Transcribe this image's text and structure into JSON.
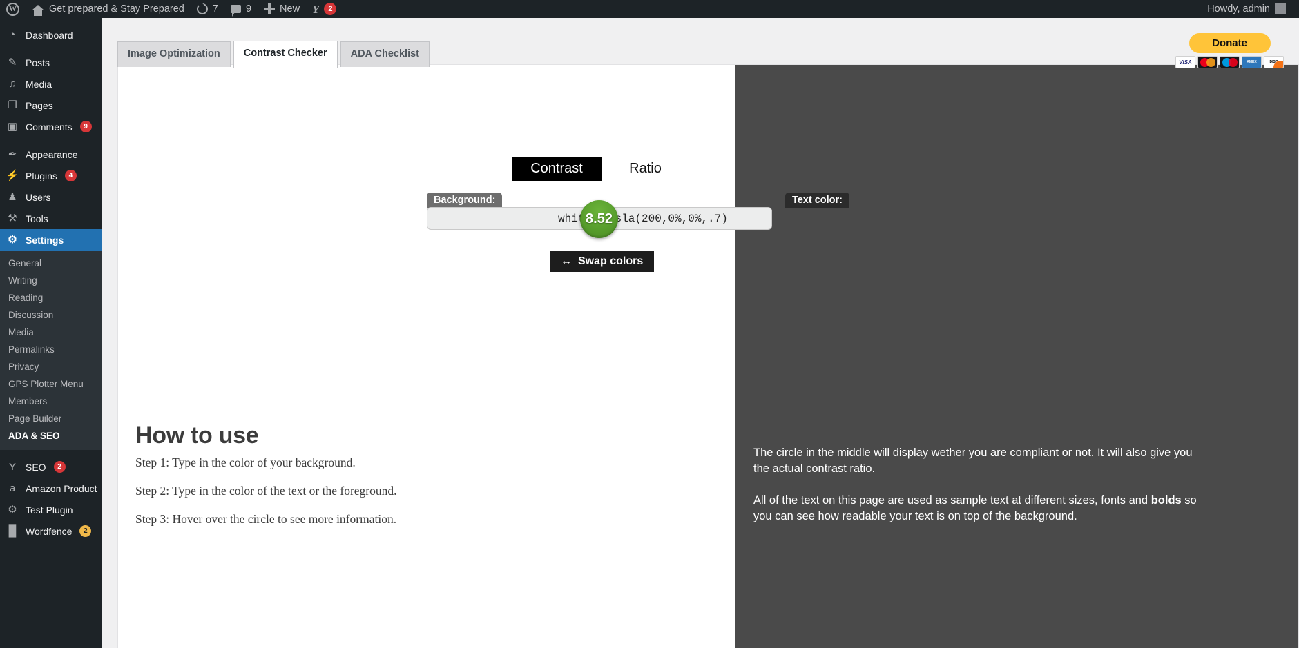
{
  "adminbar": {
    "wp_logo": "wordpress-logo-icon",
    "site_name": "Get prepared & Stay Prepared",
    "updates_count": "7",
    "comments_count": "9",
    "new_label": "New",
    "yoast_badge": "2",
    "howdy": "Howdy, admin"
  },
  "sidebar": {
    "items": [
      {
        "label": "Dashboard",
        "icon": "dashboard-icon",
        "glyph": "◔",
        "badge": ""
      },
      {
        "label": "Posts",
        "icon": "pin-icon",
        "glyph": "✎",
        "badge": ""
      },
      {
        "label": "Media",
        "icon": "media-icon",
        "glyph": "♫",
        "badge": ""
      },
      {
        "label": "Pages",
        "icon": "pages-icon",
        "glyph": "❐",
        "badge": ""
      },
      {
        "label": "Comments",
        "icon": "comments-icon",
        "glyph": "▣",
        "badge": "9"
      },
      {
        "label": "Appearance",
        "icon": "brush-icon",
        "glyph": "✒",
        "badge": ""
      },
      {
        "label": "Plugins",
        "icon": "plug-icon",
        "glyph": "⚡",
        "badge": "4"
      },
      {
        "label": "Users",
        "icon": "user-icon",
        "glyph": "♟",
        "badge": ""
      },
      {
        "label": "Tools",
        "icon": "wrench-icon",
        "glyph": "⚒",
        "badge": ""
      }
    ],
    "settings": {
      "label": "Settings",
      "icon": "settings-sliders-icon",
      "glyph": "⚙"
    },
    "submenu": [
      {
        "label": "General",
        "current": false
      },
      {
        "label": "Writing",
        "current": false
      },
      {
        "label": "Reading",
        "current": false
      },
      {
        "label": "Discussion",
        "current": false
      },
      {
        "label": "Media",
        "current": false
      },
      {
        "label": "Permalinks",
        "current": false
      },
      {
        "label": "Privacy",
        "current": false
      },
      {
        "label": "GPS Plotter Menu",
        "current": false
      },
      {
        "label": "Members",
        "current": false
      },
      {
        "label": "Page Builder",
        "current": false
      },
      {
        "label": "ADA & SEO",
        "current": true
      }
    ],
    "plugins": [
      {
        "label": "SEO",
        "icon": "yoast-icon",
        "glyph": "Y",
        "badge": "2",
        "badge_color": "red"
      },
      {
        "label": "Amazon Product",
        "icon": "amazon-icon",
        "glyph": "a",
        "badge": "",
        "badge_color": ""
      },
      {
        "label": "Test Plugin",
        "icon": "gear-icon",
        "glyph": "⚙",
        "badge": "",
        "badge_color": ""
      },
      {
        "label": "Wordfence",
        "icon": "wordfence-icon",
        "glyph": "█",
        "badge": "2",
        "badge_color": "yellow"
      }
    ]
  },
  "donate": {
    "button_label": "Donate",
    "cards": [
      {
        "name": "visa-card-icon",
        "label": "VISA"
      },
      {
        "name": "mastercard-card-icon",
        "label": ""
      },
      {
        "name": "maestro-card-icon",
        "label": ""
      },
      {
        "name": "amex-card-icon",
        "label": "AMERICAN EXPRESS"
      },
      {
        "name": "discover-card-icon",
        "label": "DISCOVER"
      }
    ]
  },
  "tabs": [
    {
      "label": "Image Optimization",
      "active": false
    },
    {
      "label": "Contrast Checker",
      "active": true
    },
    {
      "label": "ADA Checklist",
      "active": false
    }
  ],
  "contrast_tool": {
    "title_left": "Contrast",
    "title_right": "Ratio",
    "background_label": "Background:",
    "text_color_label": "Text color:",
    "background_value": "white",
    "text_color_value": "hsla(200,0%,0%,.7)",
    "ratio_value": "8.52",
    "ratio_circle_color": "#569c2b",
    "swap_label": "Swap colors",
    "swap_icon": "↔"
  },
  "howto": {
    "heading": "How to use",
    "steps": [
      "Step 1: Type in the color of your background.",
      "Step 2: Type in the color of the text or the foreground.",
      "Step 3: Hover over the circle to see more information."
    ]
  },
  "dark_panel": {
    "paragraph1": "The circle in the middle will display wether you are compliant or not. It will also give you the actual contrast ratio.",
    "paragraph2_a": "All of the text on this page are used as sample text at different sizes, fonts and ",
    "paragraph2_bold": "bolds",
    "paragraph2_b": " so you can see how readable your text is on top of the background."
  }
}
